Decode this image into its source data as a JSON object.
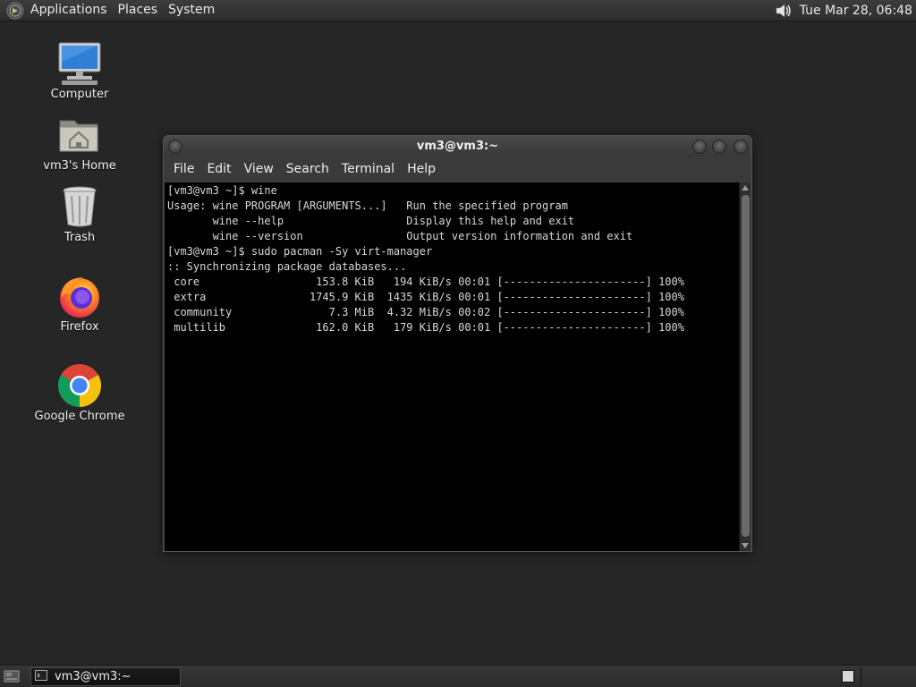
{
  "top_panel": {
    "menus": [
      "Applications",
      "Places",
      "System"
    ],
    "clock": "Tue Mar 28, 06:48",
    "icons": {
      "menu_logo": "mint-logo-icon",
      "volume": "volume-icon"
    }
  },
  "desktop": {
    "icons": [
      {
        "label": "Computer",
        "icon": "computer-icon"
      },
      {
        "label": "vm3's Home",
        "icon": "home-folder-icon"
      },
      {
        "label": "Trash",
        "icon": "trash-icon"
      },
      {
        "label": "Firefox",
        "icon": "firefox-icon"
      },
      {
        "label": "Google Chrome",
        "icon": "chrome-icon"
      }
    ]
  },
  "terminal": {
    "title": "vm3@vm3:~",
    "menu": [
      "File",
      "Edit",
      "View",
      "Search",
      "Terminal",
      "Help"
    ],
    "lines": [
      "[vm3@vm3 ~]$ wine",
      "Usage: wine PROGRAM [ARGUMENTS...]   Run the specified program",
      "       wine --help                   Display this help and exit",
      "       wine --version                Output version information and exit",
      "[vm3@vm3 ~]$ sudo pacman -Sy virt-manager",
      ":: Synchronizing package databases...",
      " core                  153.8 KiB   194 KiB/s 00:01 [----------------------] 100%",
      " extra                1745.9 KiB  1435 KiB/s 00:01 [----------------------] 100%",
      " community               7.3 MiB  4.32 MiB/s 00:02 [----------------------] 100%",
      " multilib              162.0 KiB   179 KiB/s 00:01 [----------------------] 100%"
    ]
  },
  "bottom_panel": {
    "task_label": "vm3@vm3:~",
    "icons": {
      "show_desktop": "show-desktop-icon",
      "task": "terminal-icon"
    }
  },
  "colors": {
    "desktop_bg": "#262626",
    "panel_bg": "#333333",
    "terminal_bg": "#000000",
    "terminal_fg": "#d8d8d8"
  }
}
